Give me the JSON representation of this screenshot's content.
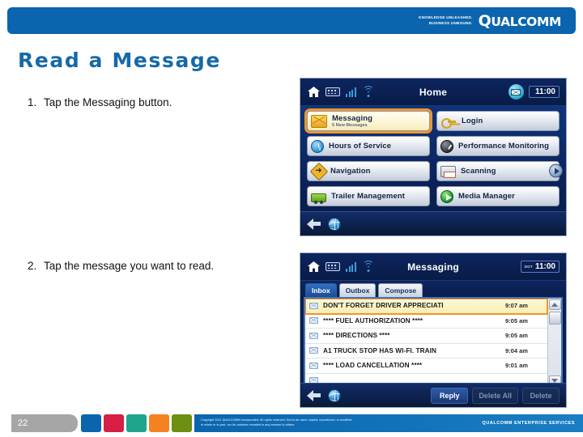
{
  "banner": {
    "tagline_line1": "KNOWLEDGE UNLEASHED.",
    "tagline_line2": "BUSINESS UNBOUND.",
    "logo_q": "Q",
    "logo_rest": "UALCOMM"
  },
  "slide": {
    "title": "Read a Message",
    "steps": [
      {
        "number": "1.",
        "text": "Tap the Messaging button."
      },
      {
        "number": "2.",
        "text": "Tap the message you want to read."
      }
    ]
  },
  "home_screen": {
    "status_bar": {
      "title": "Home",
      "time": "11:00",
      "dot_label": "",
      "icons": [
        "home-icon",
        "keyboard-icon",
        "signal-icon",
        "wifi-icon",
        "envelope-icon"
      ]
    },
    "tiles": [
      {
        "label": "Messaging",
        "sublabel": "5 New Messages",
        "icon": "mail-icon",
        "highlighted": true
      },
      {
        "label": "Login",
        "sublabel": "",
        "icon": "key-icon",
        "highlighted": false
      },
      {
        "label": "Hours of Service",
        "sublabel": "",
        "icon": "clock-icon",
        "highlighted": false
      },
      {
        "label": "Performance Monitoring",
        "sublabel": "",
        "icon": "gauge-icon",
        "highlighted": false
      },
      {
        "label": "Navigation",
        "sublabel": "",
        "icon": "navigation-icon",
        "highlighted": false
      },
      {
        "label": "Scanning",
        "sublabel": "",
        "icon": "printer-icon",
        "highlighted": false
      },
      {
        "label": "Trailer Management",
        "sublabel": "",
        "icon": "trailer-icon",
        "highlighted": false
      },
      {
        "label": "Media Manager",
        "sublabel": "",
        "icon": "play-icon",
        "highlighted": false
      }
    ]
  },
  "messaging_screen": {
    "status_bar": {
      "title": "Messaging",
      "time": "11:00",
      "dot_label": "DOT"
    },
    "tabs": [
      {
        "label": "Inbox",
        "active": true
      },
      {
        "label": "Outbox",
        "active": false
      },
      {
        "label": "Compose",
        "active": false
      }
    ],
    "messages": [
      {
        "subject": "DON'T FORGET DRIVER APPRECIATI",
        "time": "9:07 am",
        "selected": true
      },
      {
        "subject": "**** FUEL AUTHORIZATION ****",
        "time": "9:05 am",
        "selected": false
      },
      {
        "subject": "**** DIRECTIONS ****",
        "time": "9:05 am",
        "selected": false
      },
      {
        "subject": "A1 TRUCK STOP HAS WI-FI. TRAIN",
        "time": "9:04 am",
        "selected": false
      },
      {
        "subject": "**** LOAD CANCELLATION ****",
        "time": "9:01 am",
        "selected": false
      }
    ],
    "actions": [
      {
        "label": "Reply",
        "enabled": true
      },
      {
        "label": "Delete All",
        "enabled": false
      },
      {
        "label": "Delete",
        "enabled": false
      }
    ]
  },
  "footer": {
    "page_number": "22",
    "squares": [
      "#0a65ae",
      "#d81e45",
      "#1fa58b",
      "#f58220",
      "#6d8f12",
      "#2e1a78"
    ],
    "copyright_line1": "Copyright 2011 QUALCOMM Incorporated. All rights reserved. Not to be used, copied, reproduced, or modified",
    "copyright_line2": "in whole or in part, nor its contents revealed in any manner to others.",
    "brand": "QUALCOMM ENTERPRISE SERVICES"
  }
}
